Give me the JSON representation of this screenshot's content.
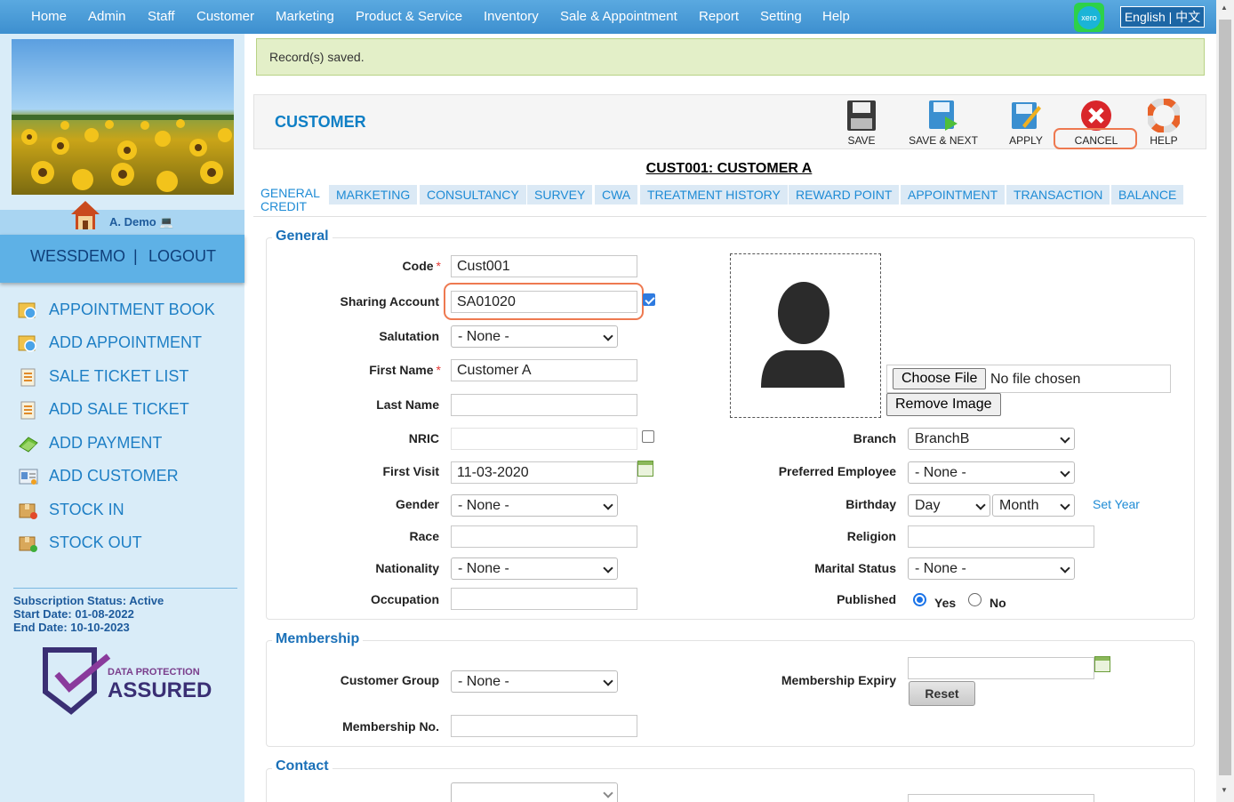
{
  "nav": {
    "items": [
      "Home",
      "Admin",
      "Staff",
      "Customer",
      "Marketing",
      "Product & Service",
      "Inventory",
      "Sale & Appointment",
      "Report",
      "Setting",
      "Help"
    ],
    "xero": "xero",
    "lang_en": "English",
    "lang_sep": "|",
    "lang_cn": "中文"
  },
  "sidebar": {
    "user_name": "A. Demo",
    "account": "WESSDEMO",
    "separator": "|",
    "logout": "LOGOUT",
    "menu": [
      {
        "label": "APPOINTMENT BOOK",
        "icon": "appointment-book-icon"
      },
      {
        "label": "ADD APPOINTMENT",
        "icon": "add-appointment-icon"
      },
      {
        "label": "SALE TICKET LIST",
        "icon": "sale-ticket-list-icon"
      },
      {
        "label": "ADD SALE TICKET",
        "icon": "add-sale-ticket-icon"
      },
      {
        "label": "ADD PAYMENT",
        "icon": "add-payment-icon"
      },
      {
        "label": "ADD CUSTOMER",
        "icon": "add-customer-icon"
      },
      {
        "label": "STOCK IN",
        "icon": "stock-in-icon"
      },
      {
        "label": "STOCK OUT",
        "icon": "stock-out-icon"
      }
    ],
    "subscription_status": "Subscription Status: Active",
    "start_date": "Start Date: 01-08-2022",
    "end_date": "End Date: 10-10-2023",
    "dpa_line1": "DATA PROTECTION",
    "dpa_line2": "ASSURED"
  },
  "alert": {
    "message": "Record(s) saved."
  },
  "toolbar": {
    "title": "CUSTOMER",
    "save": "SAVE",
    "save_next": "SAVE & NEXT",
    "apply": "APPLY",
    "cancel": "CANCEL",
    "help": "HELP"
  },
  "record_title": "CUST001: CUSTOMER A",
  "tabs": [
    "GENERAL CREDIT",
    "MARKETING",
    "CONSULTANCY",
    "SURVEY",
    "CWA",
    "TREATMENT HISTORY",
    "REWARD POINT",
    "APPOINTMENT",
    "TRANSACTION",
    "BALANCE"
  ],
  "general": {
    "legend": "General",
    "code_label": "Code",
    "code_value": "Cust001",
    "sharing_label": "Sharing Account",
    "sharing_value": "SA01020",
    "salutation_label": "Salutation",
    "salutation_value": "- None -",
    "firstname_label": "First Name",
    "firstname_value": "Customer A",
    "lastname_label": "Last Name",
    "lastname_value": "",
    "nric_label": "NRIC",
    "nric_value": "",
    "firstvisit_label": "First Visit",
    "firstvisit_value": "11-03-2020",
    "gender_label": "Gender",
    "gender_value": "- None -",
    "race_label": "Race",
    "race_value": "",
    "nationality_label": "Nationality",
    "nationality_value": "- None -",
    "occupation_label": "Occupation",
    "occupation_value": "",
    "choose_file": "Choose File",
    "no_file": "No file chosen",
    "remove_image": "Remove Image",
    "branch_label": "Branch",
    "branch_value": "BranchB",
    "pref_emp_label": "Preferred Employee",
    "pref_emp_value": "- None -",
    "birthday_label": "Birthday",
    "birthday_day": "Day",
    "birthday_month": "Month",
    "set_year": "Set Year",
    "religion_label": "Religion",
    "religion_value": "",
    "marital_label": "Marital Status",
    "marital_value": "- None -",
    "published_label": "Published",
    "yes": "Yes",
    "no": "No",
    "required_mark": "*"
  },
  "membership": {
    "legend": "Membership",
    "group_label": "Customer Group",
    "group_value": "- None -",
    "number_label": "Membership No.",
    "number_value": "",
    "expiry_label": "Membership Expiry",
    "expiry_value": "",
    "reset": "Reset"
  },
  "contact": {
    "legend": "Contact"
  }
}
